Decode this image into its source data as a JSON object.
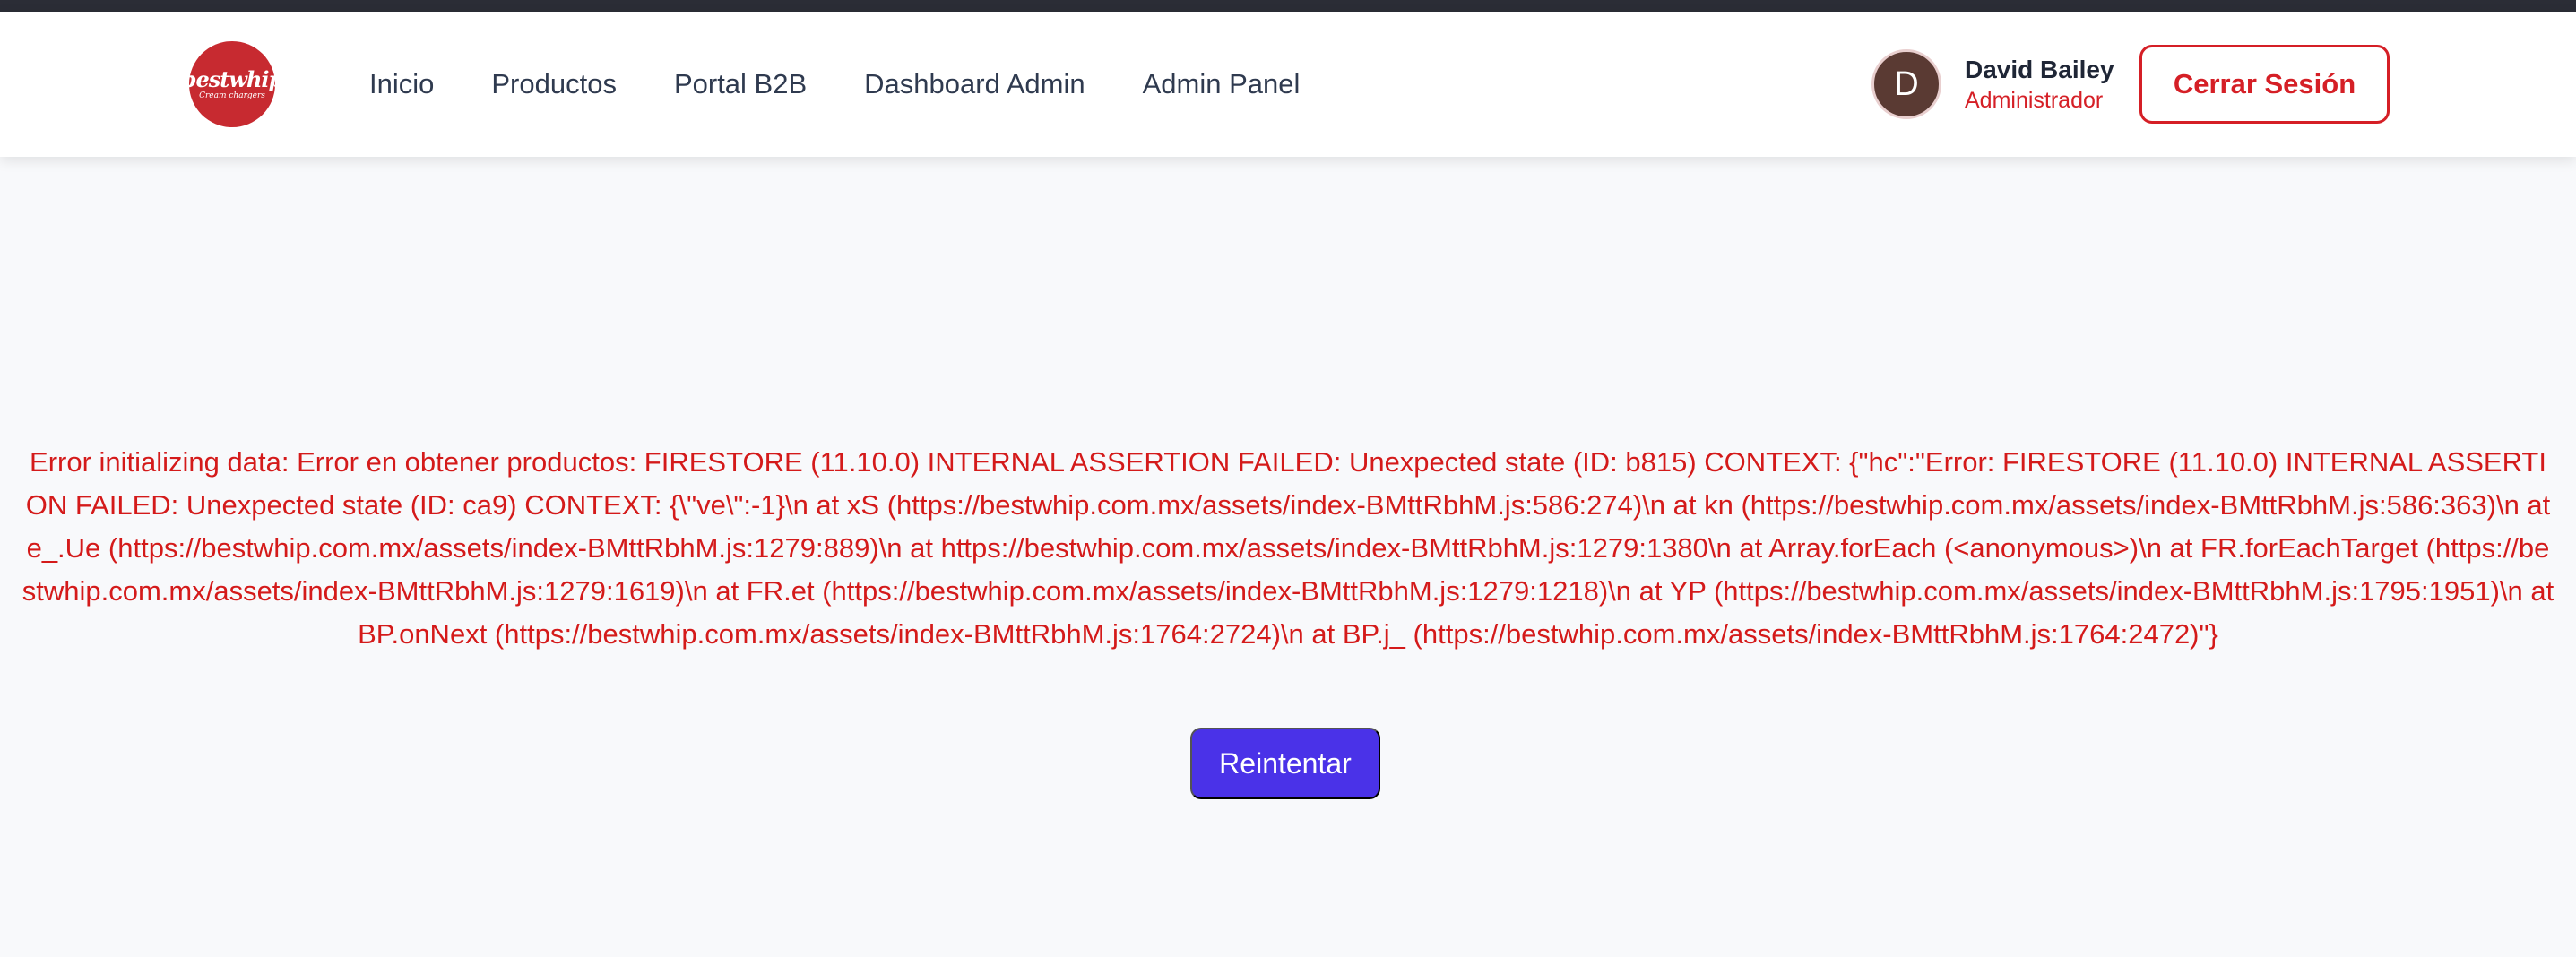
{
  "brand": {
    "logo_text": "bestwhip",
    "logo_subtext": "Cream chargers",
    "color": "#c72a30"
  },
  "nav": {
    "links": [
      "Inicio",
      "Productos",
      "Portal B2B",
      "Dashboard Admin",
      "Admin Panel"
    ]
  },
  "user": {
    "initial": "D",
    "name": "David Bailey",
    "role": "Administrador",
    "logout_label": "Cerrar Sesión"
  },
  "error": {
    "message": "Error initializing data: Error en obtener productos: FIRESTORE (11.10.0) INTERNAL ASSERTION FAILED: Unexpected state (ID: b815) CONTEXT: {\"hc\":\"Error: FIRESTORE (11.10.0) INTERNAL ASSERTION FAILED: Unexpected state (ID: ca9) CONTEXT: {\\\"ve\\\":-1}\\n at xS (https://bestwhip.com.mx/assets/index-BMttRbhM.js:586:274)\\n at kn (https://bestwhip.com.mx/assets/index-BMttRbhM.js:586:363)\\n at e_.Ue (https://bestwhip.com.mx/assets/index-BMttRbhM.js:1279:889)\\n at https://bestwhip.com.mx/assets/index-BMttRbhM.js:1279:1380\\n at Array.forEach (<anonymous>)\\n at FR.forEachTarget (https://bestwhip.com.mx/assets/index-BMttRbhM.js:1279:1619)\\n at FR.et (https://bestwhip.com.mx/assets/index-BMttRbhM.js:1279:1218)\\n at YP (https://bestwhip.com.mx/assets/index-BMttRbhM.js:1795:1951)\\n at BP.onNext (https://bestwhip.com.mx/assets/index-BMttRbhM.js:1764:2724)\\n at BP.j_ (https://bestwhip.com.mx/assets/index-BMttRbhM.js:1764:2472)\"}",
    "retry_label": "Reintentar",
    "color": "#d41a1a"
  },
  "colors": {
    "accent": "#4a32e8",
    "danger": "#d51f26"
  }
}
